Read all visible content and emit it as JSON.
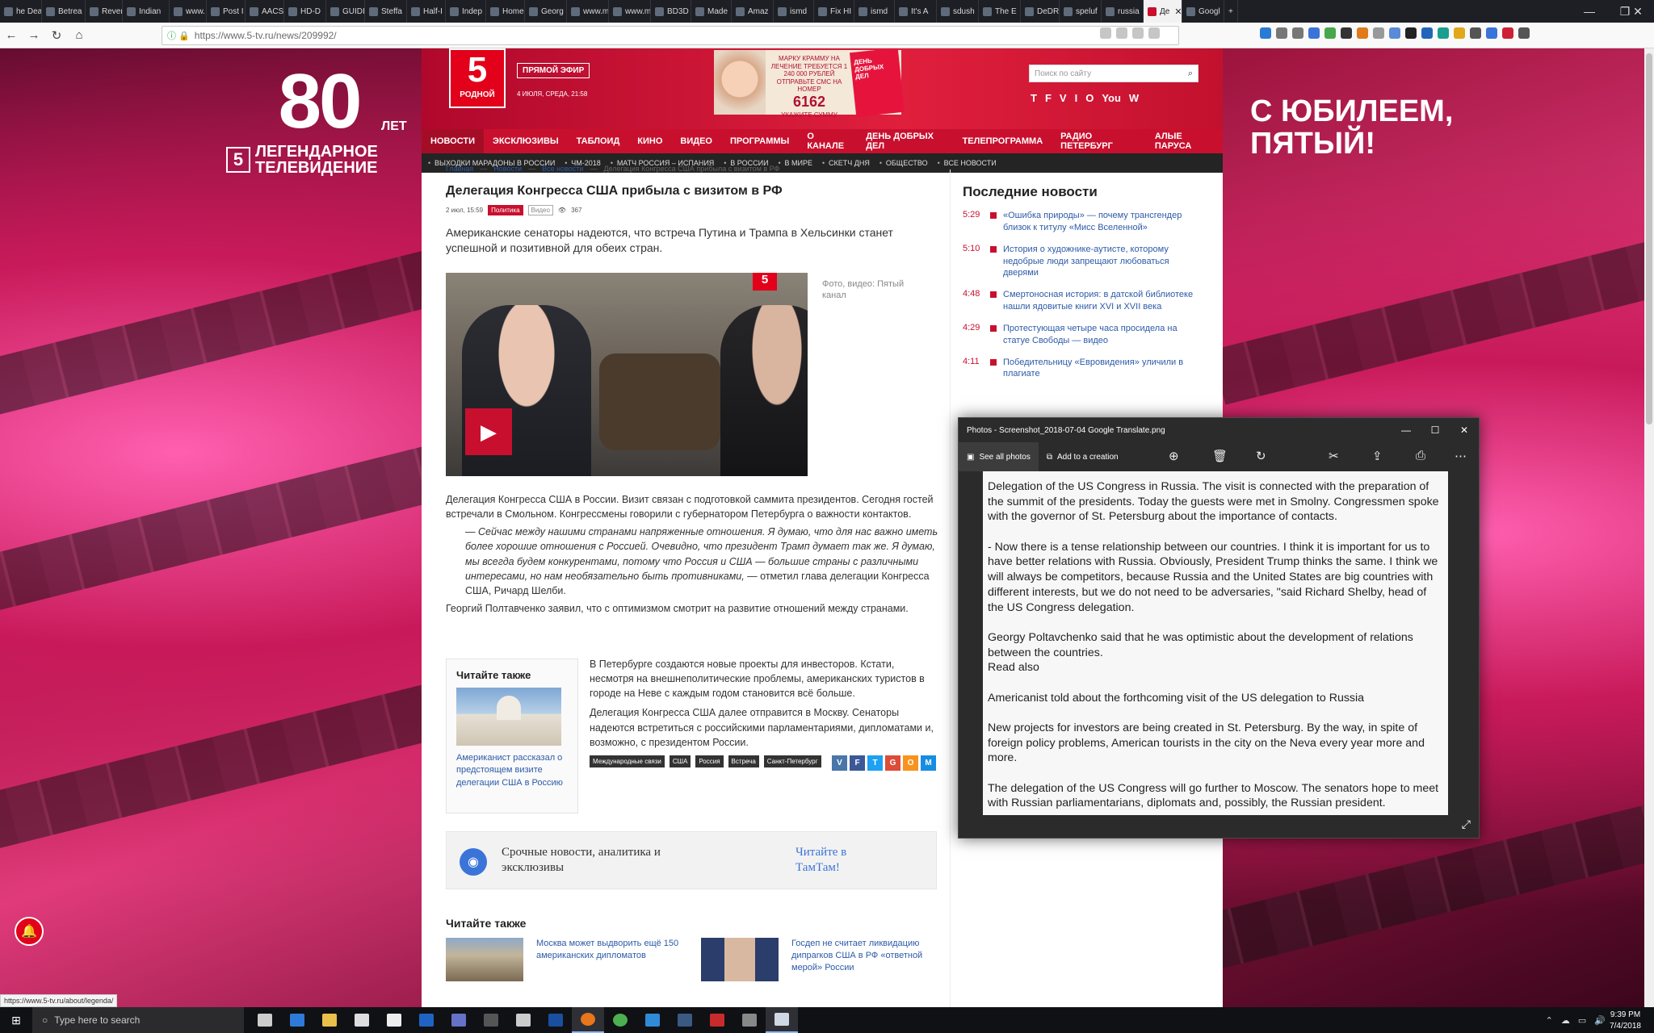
{
  "tabs": [
    "he Death",
    "Betrea",
    "Rever",
    "Indian",
    "www.",
    "Post I",
    "AACS",
    "HD-D",
    "GUIDI",
    "Steffa",
    "Half-I",
    "Indep",
    "Home",
    "Georg",
    "www.ma",
    "www.ma",
    "BD3D",
    "Made",
    "Amaz",
    "ismd",
    "Fix HI",
    "ismd",
    "It's A",
    "sdush",
    "The E",
    "DeDR",
    "speluf",
    "russia",
    "Де",
    "Googl"
  ],
  "active_tab_index": 28,
  "url": "https://www.5-tv.ru/news/209992/",
  "site": {
    "anniv_big": "80",
    "anniv_let": "ЛЕТ",
    "anniv_logo": "5",
    "anniv_line1": "ЛЕГЕНДАРНОЕ",
    "anniv_line2": "ТЕЛЕВИДЕНИЕ",
    "jubilee_line1": "С ЮБИЛЕЕМ,",
    "jubilee_line2": "ПЯТЫЙ!",
    "logo_num": "5",
    "logo_label": "РОДНОЙ",
    "live": "ПРЯМОЙ ЭФИР",
    "date": "4 ИЮЛЯ, СРЕДА, 21:58",
    "banner_text": "МАРКУ КРАММУ НА ЛЕЧЕНИЕ ТРЕБУЕТСЯ 1 240 000 РУБЛЕЙ ОТПРАВЬТЕ СМС НА НОМЕР",
    "banner_number": "6162",
    "banner_sub": "УКАЖИТЕ СУММУ",
    "banner_kind": "ДЕНЬ ДОБРЫХ ДЕЛ",
    "search_placeholder": "Поиск по сайту",
    "social": [
      "t",
      "f",
      "vk",
      "ig",
      "ok",
      "YouTube",
      "wa"
    ],
    "menu": [
      "НОВОСТИ",
      "ЭКСКЛЮЗИВЫ",
      "ТАБЛОИД",
      "КИНО",
      "ВИДЕО",
      "ПРОГРАММЫ",
      "О КАНАЛЕ",
      "ДЕНЬ ДОБРЫХ ДЕЛ",
      "ТЕЛЕПРОГРАММА",
      "РАДИО ПЕТЕРБУРГ",
      "АЛЫЕ ПАРУСА"
    ],
    "submenu": [
      "ВЫХОДКИ МАРАДОНЫ В РОССИИ",
      "ЧМ-2018",
      "МАТЧ РОССИЯ – ИСПАНИЯ",
      "В РОССИИ",
      "В МИРЕ",
      "СКЕТЧ ДНЯ",
      "ОБЩЕСТВО",
      "ВСЕ НОВОСТИ"
    ]
  },
  "breadcrumb": [
    "Главная",
    "Новости",
    "Все новости",
    "Делегация Конгресса США прибыла с визитом в РФ"
  ],
  "article": {
    "title": "Делегация Конгресса США прибыла с визитом в РФ",
    "date": "2 июл, 15:59",
    "tag": "Политика",
    "tag2": "Видео",
    "views": "367",
    "lead": "Американские сенаторы надеются, что встреча Путина и Трампа в Хельсинки станет успешной и позитивной для обеих стран.",
    "caption": "Фото, видео: Пятый канал",
    "video_logo": "5",
    "p1": "Делегация Конгресса США в России. Визит связан с подготовкой саммита президентов. Сегодня гостей встречали в Смольном. Конгрессмены говорили  с губернатором Петербурга о важности контактов.",
    "quote": "— Сейчас между нашими странами напряженные отношения. Я думаю, что для нас важно иметь более хорошие отношения с Россией. Очевидно, что президент Трамп думает так же. Я думаю, мы всегда будем конкурентами, потому что Россия и США — большие страны с различными интересами, но нам необязательно быть противниками,",
    "quote_attr": " — отметил глава делегации Конгресса США, Ричард Шелби.",
    "p2": "Георгий Полтавченко заявил, что с оптимизмом смотрит на развитие отношений между странами.",
    "read_also_head": "Читайте также",
    "read_also_link": "Американист рассказал о предстоящем визите делегации США в Россию",
    "p3": "В Петербурге создаются новые проекты для инвесторов. Кстати, несмотря на внешнеполитические проблемы, американских туристов в городе на Неве с каждым годом становится всё больше.",
    "p4": "Делегация Конгресса США далее отправится в Москву. Сенаторы надеются встретиться с российскими парламентариями, дипломатами и, возможно, с президентом России.",
    "tags": [
      "Международные связи",
      "США",
      "Россия",
      "Встреча",
      "Санкт-Петербург"
    ],
    "share": [
      "vk",
      "f",
      "t",
      "g+",
      "ok",
      "m"
    ]
  },
  "tamtam": {
    "left": "Срочные новости, аналитика и эксклюзивы",
    "right": "Читайте в ТамТам!"
  },
  "also": {
    "head": "Читайте также",
    "items": [
      "Москва может выдворить ещё 150 американских дипломатов",
      "Госдеп не считает ликвидацию дипparков США в РФ «ответной мерой» России"
    ]
  },
  "latest": {
    "head": "Последние новости",
    "items": [
      {
        "time": "5:29",
        "text": "«Ошибка природы» — почему трансгендер близок к титулу «Мисс Вселенной»"
      },
      {
        "time": "5:10",
        "text": "История о художнике-аутисте, которому недобрые люди запрещают любоваться дверями"
      },
      {
        "time": "4:48",
        "text": "Смертоносная история: в датской библиотеке нашли ядовитые книги XVI и XVII века"
      },
      {
        "time": "4:29",
        "text": "Протестующая четыре часа просидела на статуе Свободы — видео"
      },
      {
        "time": "4:11",
        "text": "Победительницу «Евровидения» уличили в плагиате"
      }
    ]
  },
  "status_url": "https://www.5-tv.ru/about/legenda/",
  "photos": {
    "title": "Photos - Screenshot_2018-07-04 Google Translate.png",
    "see_all": "See all photos",
    "add": "Add to a creation",
    "paragraphs": [
      "Delegation of the US Congress in Russia. The visit is connected with the preparation of the summit of the presidents. Today the guests were met in Smolny. Congressmen spoke with the governor of St. Petersburg about the importance of contacts.",
      "- Now there is a tense relationship between our countries. I think it is important for us to have better relations with Russia. Obviously, President Trump thinks the same. I think we will always be competitors, because Russia and the United States are big countries with different interests, but we do not need to be adversaries, \"said Richard Shelby, head of the US Congress delegation.",
      "Georgy Poltavchenko said that he was optimistic about the development of relations between the countries.\nRead also",
      "Americanist told about the forthcoming visit of the US delegation to Russia",
      "New projects for investors are being created in St. Petersburg. By the way, in spite of foreign policy problems, American tourists in the city on the Neva every year more and more.",
      "The delegation of the US Congress will go further to Moscow. The senators hope to meet with Russian parliamentarians, diplomats and, possibly, the Russian president."
    ]
  },
  "taskbar": {
    "search": "Type here to search",
    "time": "9:39 PM",
    "date": "7/4/2018"
  },
  "colors": {
    "brand_red": "#c8102e",
    "link": "#2c5aa8"
  }
}
